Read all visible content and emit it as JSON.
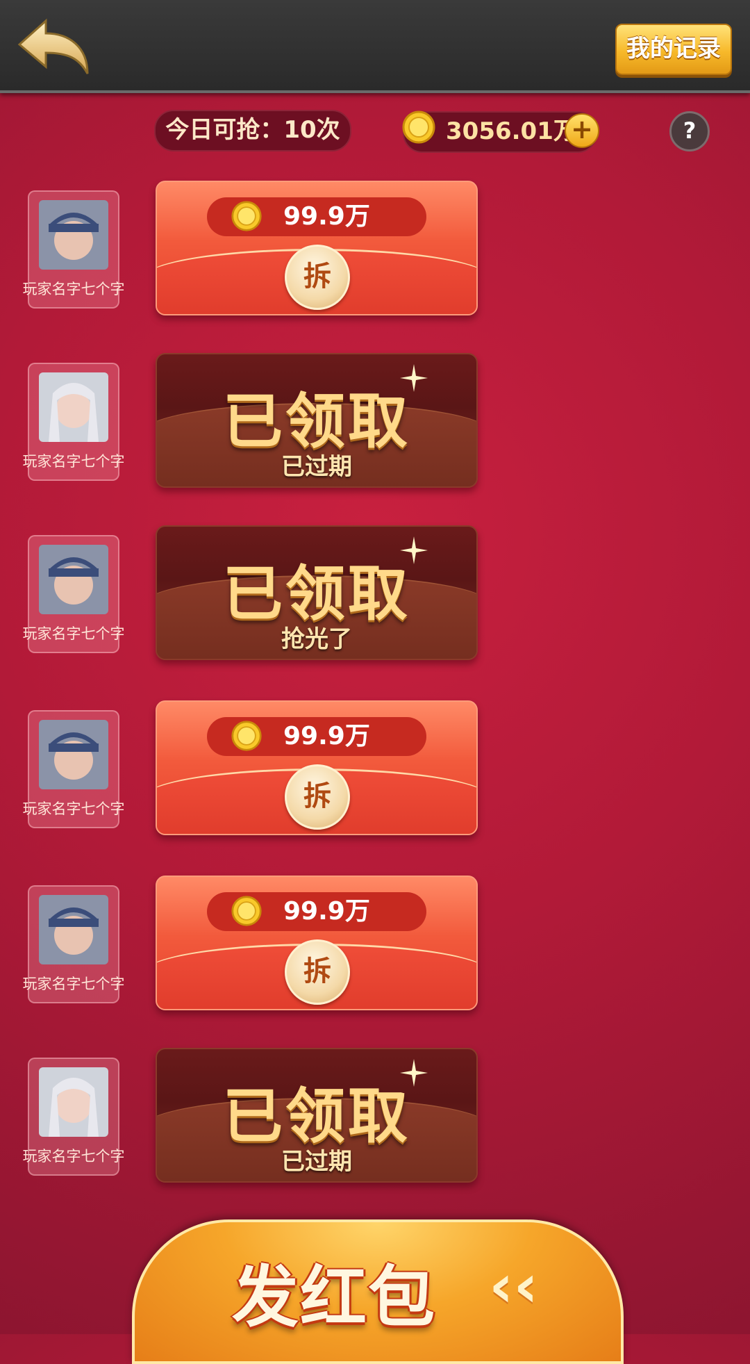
{
  "header": {
    "records_label": "我的记录",
    "quota_text": "今日可抢：10次",
    "balance_text": "3056.01万",
    "plus_label": "+",
    "help_label": "?"
  },
  "packets": [
    {
      "player": "玩家名字七个字",
      "state": "open",
      "amount": "99.9万",
      "open_label": "拆"
    },
    {
      "player": "玩家名字七个字",
      "state": "done",
      "title": "已领取",
      "sub": "已过期"
    },
    {
      "player": "玩家名字七个字",
      "state": "done",
      "title": "已领取",
      "sub": "抢光了"
    },
    {
      "player": "玩家名字七个字",
      "state": "open",
      "amount": "99.9万",
      "open_label": "拆"
    },
    {
      "player": "玩家名字七个字",
      "state": "open",
      "amount": "99.9万",
      "open_label": "拆"
    },
    {
      "player": "玩家名字七个字",
      "state": "done",
      "title": "已领取",
      "sub": "已过期"
    }
  ],
  "footer": {
    "send_label": "发红包",
    "arrows": "‹‹"
  },
  "colors": {
    "background": "#b21a38",
    "gold": "#f7b92a",
    "packet_open": "#f25a3c",
    "packet_done": "#5a1616"
  }
}
